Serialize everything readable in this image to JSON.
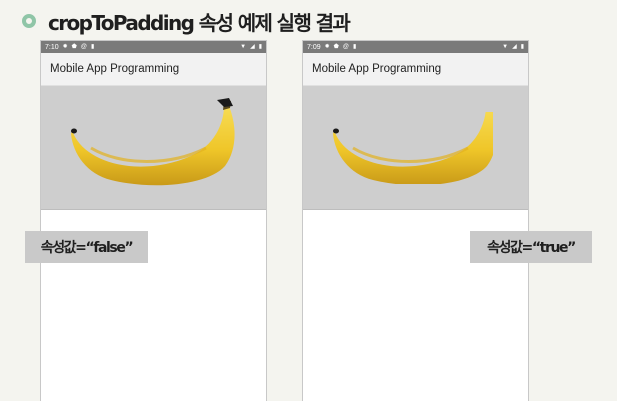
{
  "slide": {
    "title": "cropToPadding 속성 예제 실행 결과"
  },
  "phones": [
    {
      "status": {
        "time": "7:10",
        "icons": [
          "gear-icon",
          "shield-icon",
          "at-icon",
          "sd-card-icon"
        ]
      },
      "app_title": "Mobile App Programming",
      "caption": "속성값=“false”"
    },
    {
      "status": {
        "time": "7:09",
        "icons": [
          "gear-icon",
          "shield-icon",
          "at-icon",
          "sd-card-icon"
        ]
      },
      "app_title": "Mobile App Programming",
      "caption": "속성값=“true”"
    }
  ],
  "colors": {
    "status_bar": "#7a7a7a",
    "app_bar": "#f2f2f2",
    "image_background": "#cecece",
    "caption_background": "#c9c9c9",
    "bullet": "#8fc5a7",
    "banana_yellow": "#f2cb30"
  }
}
